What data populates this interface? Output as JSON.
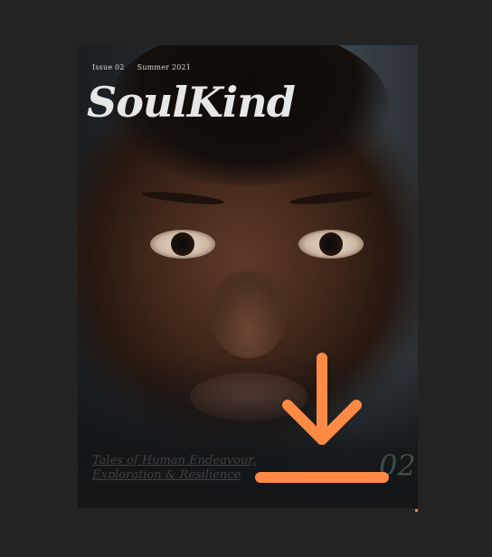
{
  "cover": {
    "issue": "Issue 02",
    "season": "Summer 2021",
    "title": "SoulKind",
    "tagline_line1": "Tales of Human Endeavour,",
    "tagline_line2": "Exploration & Resilience",
    "issue_number": "02"
  },
  "download": {
    "icon": "download-icon",
    "color": "#ff8a45"
  },
  "colors": {
    "background": "#232323",
    "accent": "#ff8a45"
  }
}
